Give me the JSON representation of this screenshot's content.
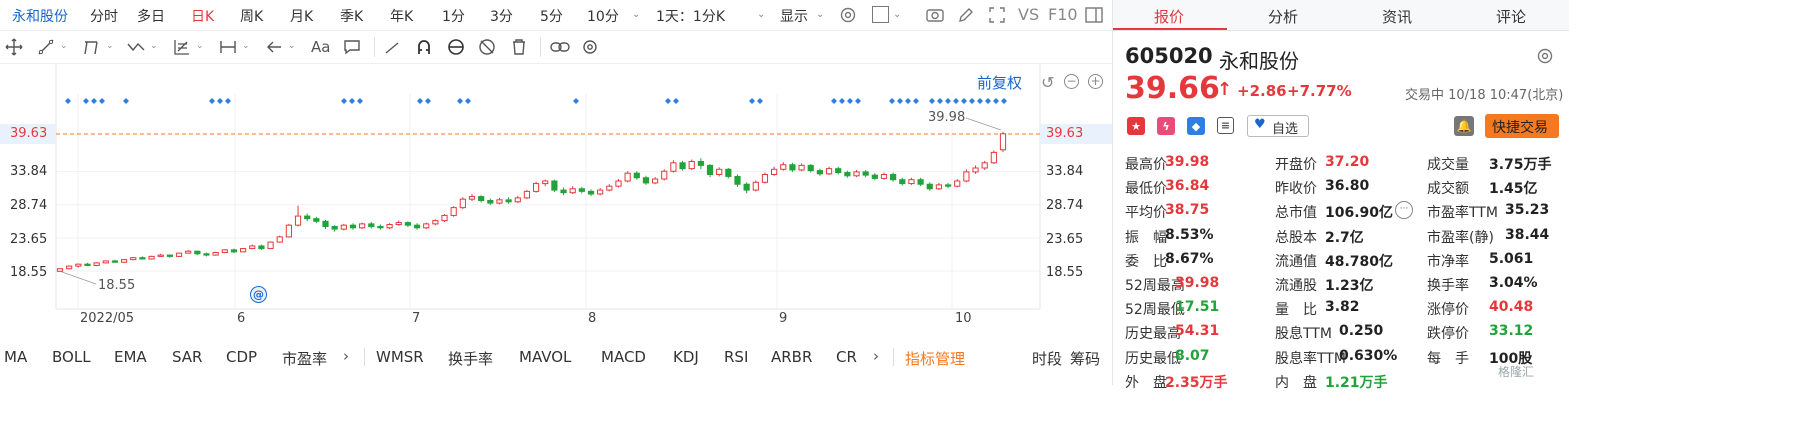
{
  "stock_tab": "永和股份",
  "timeframes": [
    "分时",
    "多日",
    "日K",
    "周K",
    "月K",
    "季K",
    "年K",
    "1分",
    "3分",
    "5分",
    "10分",
    "1天：1分K"
  ],
  "active_timeframe": "日K",
  "display_label": "显示",
  "vs_label": "VS",
  "f10_label": "F10",
  "chart": {
    "fq_label": "前复权",
    "price_labels": [
      "39.63",
      "33.84",
      "28.74",
      "23.65",
      "18.55"
    ],
    "current_price_line": "39.63",
    "high_annotation": "39.98",
    "low_annotation": "18.55",
    "x_labels": [
      "2022/05",
      "6",
      "7",
      "8",
      "9",
      "10"
    ]
  },
  "indicator_tabs": [
    "MA",
    "BOLL",
    "EMA",
    "SAR",
    "CDP",
    "市盈率",
    "WMSR",
    "换手率",
    "MAVOL",
    "MACD",
    "KDJ",
    "RSI",
    "ARBR",
    "CR"
  ],
  "indicator_manage": "指标管理",
  "side_links": [
    "时段",
    "筹码"
  ],
  "panel": {
    "tabs": [
      "报价",
      "分析",
      "资讯",
      "评论"
    ],
    "active_tab": "报价",
    "code": "605020",
    "name": "永和股份",
    "price": "39.66",
    "change": "+2.86",
    "change_pct": "+7.77%",
    "status": "交易中 10/18 10:47(北京)",
    "watch_label": "自选",
    "trade_label": "快捷交易",
    "stats": [
      [
        {
          "label": "最高价",
          "value": "39.98",
          "color": "red"
        },
        {
          "label": "开盘价",
          "value": "37.20",
          "color": "red"
        },
        {
          "label": "成交量",
          "value": "3.75万手",
          "color": "dark"
        }
      ],
      [
        {
          "label": "最低价",
          "value": "36.84",
          "color": "red"
        },
        {
          "label": "昨收价",
          "value": "36.80",
          "color": "dark"
        },
        {
          "label": "成交额",
          "value": "1.45亿",
          "color": "dark"
        }
      ],
      [
        {
          "label": "平均价",
          "value": "38.75",
          "color": "red"
        },
        {
          "label": "总市值",
          "value": "106.90亿",
          "color": "dark"
        },
        {
          "label": "市盈率TTM",
          "value": "35.23",
          "color": "dark"
        }
      ],
      [
        {
          "label": "振　幅",
          "value": "8.53%",
          "color": "dark"
        },
        {
          "label": "总股本",
          "value": "2.7亿",
          "color": "dark"
        },
        {
          "label": "市盈率(静)",
          "value": "38.44",
          "color": "dark"
        }
      ],
      [
        {
          "label": "委　比",
          "value": "8.67%",
          "color": "dark"
        },
        {
          "label": "流通值",
          "value": "48.780亿",
          "color": "dark"
        },
        {
          "label": "市净率",
          "value": "5.061",
          "color": "dark"
        }
      ],
      [
        {
          "label": "52周最高",
          "value": "39.98",
          "color": "red"
        },
        {
          "label": "流通股",
          "value": "1.23亿",
          "color": "dark"
        },
        {
          "label": "换手率",
          "value": "3.04%",
          "color": "dark"
        }
      ],
      [
        {
          "label": "52周最低",
          "value": "17.51",
          "color": "green"
        },
        {
          "label": "量　比",
          "value": "3.82",
          "color": "dark"
        },
        {
          "label": "涨停价",
          "value": "40.48",
          "color": "red"
        }
      ],
      [
        {
          "label": "历史最高",
          "value": "54.31",
          "color": "red"
        },
        {
          "label": "股息TTM",
          "value": "0.250",
          "color": "dark"
        },
        {
          "label": "跌停价",
          "value": "33.12",
          "color": "green"
        }
      ],
      [
        {
          "label": "历史最低",
          "value": "8.07",
          "color": "green"
        },
        {
          "label": "股息率TTM",
          "value": "0.630%",
          "color": "dark"
        },
        {
          "label": "每　手",
          "value": "100股",
          "color": "dark"
        }
      ],
      [
        {
          "label": "外　盘",
          "value": "2.35万手",
          "color": "red"
        },
        {
          "label": "内　盘",
          "value": "1.21万手",
          "color": "green"
        }
      ]
    ]
  },
  "watermark": "格隆汇",
  "colors": {
    "up": "#e4393c",
    "down": "#22a33a",
    "accent": "#1a66c9",
    "trade_btn": "#f47920"
  },
  "chart_data": {
    "type": "candlestick",
    "y_ticks": [
      18.55,
      23.65,
      28.74,
      33.84,
      39.63
    ],
    "high": 39.98,
    "low": 18.55,
    "candles": [
      [
        18.5,
        18.9,
        18.4,
        18.95
      ],
      [
        18.9,
        19.3,
        18.8,
        19.4
      ],
      [
        19.3,
        19.6,
        19.1,
        19.7
      ],
      [
        19.6,
        19.4,
        19.3,
        19.8
      ],
      [
        19.4,
        19.8,
        19.3,
        19.9
      ],
      [
        19.8,
        20.1,
        19.7,
        20.2
      ],
      [
        20.1,
        19.9,
        19.8,
        20.3
      ],
      [
        19.9,
        20.3,
        19.8,
        20.4
      ],
      [
        20.3,
        20.6,
        20.2,
        20.7
      ],
      [
        20.6,
        20.4,
        20.3,
        20.8
      ],
      [
        20.4,
        20.8,
        20.3,
        20.9
      ],
      [
        20.8,
        21.0,
        20.7,
        21.2
      ],
      [
        21.0,
        20.8,
        20.6,
        21.1
      ],
      [
        20.8,
        21.3,
        20.7,
        21.4
      ],
      [
        21.3,
        21.6,
        21.2,
        21.8
      ],
      [
        21.6,
        21.2,
        21.0,
        21.7
      ],
      [
        21.2,
        21.0,
        20.8,
        21.4
      ],
      [
        21.0,
        21.4,
        20.9,
        21.5
      ],
      [
        21.4,
        21.8,
        21.3,
        21.9
      ],
      [
        21.8,
        21.5,
        21.3,
        22.0
      ],
      [
        21.5,
        22.0,
        21.4,
        22.1
      ],
      [
        22.0,
        22.4,
        21.9,
        22.6
      ],
      [
        22.4,
        22.0,
        21.8,
        22.6
      ],
      [
        22.0,
        23.0,
        21.9,
        23.1
      ],
      [
        23.0,
        23.8,
        22.9,
        24.0
      ],
      [
        23.8,
        25.6,
        23.7,
        25.8
      ],
      [
        25.6,
        27.0,
        25.4,
        28.6
      ],
      [
        27.0,
        26.6,
        26.2,
        27.4
      ],
      [
        26.6,
        26.2,
        25.9,
        26.9
      ],
      [
        26.2,
        25.4,
        25.0,
        26.4
      ],
      [
        25.4,
        25.0,
        24.6,
        25.6
      ],
      [
        25.0,
        25.6,
        24.8,
        25.8
      ],
      [
        25.6,
        25.2,
        24.9,
        25.9
      ],
      [
        25.2,
        25.8,
        25.0,
        26.0
      ],
      [
        25.8,
        25.4,
        25.1,
        26.1
      ],
      [
        25.4,
        25.2,
        24.9,
        25.7
      ],
      [
        25.2,
        25.7,
        25.0,
        25.9
      ],
      [
        25.7,
        26.0,
        25.5,
        26.3
      ],
      [
        26.0,
        25.6,
        25.3,
        26.2
      ],
      [
        25.6,
        25.2,
        24.9,
        25.9
      ],
      [
        25.2,
        25.8,
        25.0,
        26.0
      ],
      [
        25.8,
        26.3,
        25.6,
        26.5
      ],
      [
        26.3,
        27.1,
        26.1,
        27.3
      ],
      [
        27.1,
        28.3,
        26.9,
        28.5
      ],
      [
        28.3,
        29.6,
        28.1,
        29.9
      ],
      [
        29.6,
        30.0,
        29.3,
        30.4
      ],
      [
        30.0,
        29.4,
        29.1,
        30.2
      ],
      [
        29.4,
        29.0,
        28.7,
        29.7
      ],
      [
        29.0,
        29.5,
        28.8,
        29.8
      ],
      [
        29.5,
        29.2,
        28.9,
        29.9
      ],
      [
        29.2,
        29.8,
        29.0,
        30.1
      ],
      [
        29.8,
        30.8,
        29.6,
        31.0
      ],
      [
        30.8,
        32.0,
        30.6,
        32.3
      ],
      [
        32.0,
        32.4,
        31.6,
        32.6
      ],
      [
        32.4,
        31.0,
        30.7,
        32.6
      ],
      [
        31.0,
        30.6,
        30.2,
        31.4
      ],
      [
        30.6,
        31.2,
        30.4,
        31.6
      ],
      [
        31.2,
        30.8,
        30.5,
        31.5
      ],
      [
        30.8,
        30.4,
        30.1,
        31.1
      ],
      [
        30.4,
        31.0,
        30.2,
        31.3
      ],
      [
        31.0,
        31.6,
        30.8,
        31.9
      ],
      [
        31.6,
        32.4,
        31.4,
        32.7
      ],
      [
        32.4,
        33.6,
        32.2,
        33.9
      ],
      [
        33.6,
        32.9,
        32.6,
        33.9
      ],
      [
        32.9,
        32.1,
        31.8,
        33.2
      ],
      [
        32.1,
        32.7,
        31.9,
        33.0
      ],
      [
        32.7,
        33.9,
        32.5,
        34.2
      ],
      [
        33.9,
        35.2,
        33.7,
        35.6
      ],
      [
        35.2,
        34.3,
        34.0,
        35.5
      ],
      [
        34.3,
        35.4,
        34.1,
        35.7
      ],
      [
        35.4,
        34.8,
        34.2,
        35.9
      ],
      [
        34.8,
        33.4,
        33.0,
        35.0
      ],
      [
        33.4,
        34.2,
        33.1,
        34.5
      ],
      [
        34.2,
        33.1,
        32.8,
        34.4
      ],
      [
        33.1,
        31.9,
        31.5,
        33.4
      ],
      [
        31.9,
        31.0,
        30.5,
        32.2
      ],
      [
        31.0,
        32.2,
        30.8,
        32.5
      ],
      [
        32.2,
        33.4,
        32.0,
        33.7
      ],
      [
        33.4,
        34.2,
        33.2,
        34.6
      ],
      [
        34.2,
        34.9,
        34.0,
        35.3
      ],
      [
        34.9,
        34.1,
        33.8,
        35.2
      ],
      [
        34.1,
        34.8,
        33.9,
        35.1
      ],
      [
        34.8,
        34.0,
        33.7,
        35.0
      ],
      [
        34.0,
        33.5,
        33.2,
        34.3
      ],
      [
        33.5,
        34.3,
        33.3,
        34.6
      ],
      [
        34.3,
        33.7,
        33.4,
        34.6
      ],
      [
        33.7,
        33.2,
        32.9,
        34.0
      ],
      [
        33.2,
        33.8,
        33.0,
        34.1
      ],
      [
        33.8,
        33.3,
        33.0,
        34.1
      ],
      [
        33.3,
        32.8,
        32.5,
        33.6
      ],
      [
        32.8,
        33.4,
        32.6,
        33.7
      ],
      [
        33.4,
        32.6,
        32.3,
        33.7
      ],
      [
        32.6,
        32.0,
        31.7,
        32.9
      ],
      [
        32.0,
        32.6,
        31.8,
        32.9
      ],
      [
        32.6,
        31.9,
        31.6,
        32.9
      ],
      [
        31.9,
        31.2,
        30.9,
        32.2
      ],
      [
        31.2,
        31.8,
        31.0,
        32.1
      ],
      [
        31.8,
        31.6,
        31.3,
        32.1
      ],
      [
        31.6,
        32.4,
        31.4,
        32.7
      ],
      [
        32.4,
        33.8,
        32.2,
        34.2
      ],
      [
        33.8,
        34.4,
        33.5,
        34.8
      ],
      [
        34.4,
        35.2,
        34.1,
        35.5
      ],
      [
        35.2,
        36.8,
        35.0,
        37.1
      ],
      [
        37.2,
        39.66,
        36.84,
        39.98
      ]
    ]
  }
}
